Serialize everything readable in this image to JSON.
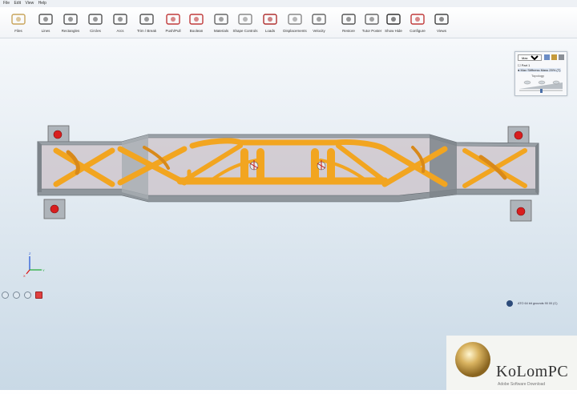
{
  "menu": {
    "items": [
      "File",
      "Edit",
      "View",
      "Help"
    ]
  },
  "toolbar": {
    "tools": [
      {
        "label": "Files",
        "icon": "files-icon"
      },
      {
        "label": "Lines",
        "icon": "lines-icon"
      },
      {
        "label": "Rectangles",
        "icon": "rectangles-icon"
      },
      {
        "label": "Circles",
        "icon": "circles-icon"
      },
      {
        "label": "Arcs",
        "icon": "arcs-icon"
      },
      {
        "label": "Trim / Break",
        "icon": "trim-break-icon"
      },
      {
        "label": "Push/Pull",
        "icon": "push-pull-icon"
      },
      {
        "label": "Boolean",
        "icon": "boolean-icon"
      },
      {
        "label": "Materials",
        "icon": "materials-icon"
      },
      {
        "label": "Shape Controls",
        "icon": "shape-controls-icon"
      },
      {
        "label": "Loads",
        "icon": "loads-icon"
      },
      {
        "label": "Displacements",
        "icon": "displacements-icon"
      },
      {
        "label": "Velocity",
        "icon": "velocity-icon"
      },
      {
        "label": "Restore",
        "icon": "restore-icon"
      },
      {
        "label": "Tutor Poster",
        "icon": "tutor-poster-icon"
      },
      {
        "label": "Show Hide",
        "icon": "show-hide-icon"
      },
      {
        "label": "Configure",
        "icon": "configure-icon"
      },
      {
        "label": "Views",
        "icon": "views-icon"
      }
    ]
  },
  "legend": {
    "dropdown_value": "Max StiffFrac",
    "part_label": "Part 1",
    "result_label": "Max Stiffness Mass 25% (T)",
    "shape_title": "Topology"
  },
  "status": {
    "text": "ATO 64 bit grounds 90 00 (C)"
  },
  "watermark": {
    "text": "KoLomPC",
    "subtext": "Adobe Software Download"
  },
  "colors": {
    "frame": "#8f969c",
    "frame_light": "#b9bfc4",
    "lattice": "#f2a520",
    "lattice_dark": "#c27512",
    "mount_hole": "#d81e1e",
    "accent": "#2d4b7a"
  },
  "axes": {
    "x": "X",
    "y": "Y",
    "z": "Z"
  }
}
